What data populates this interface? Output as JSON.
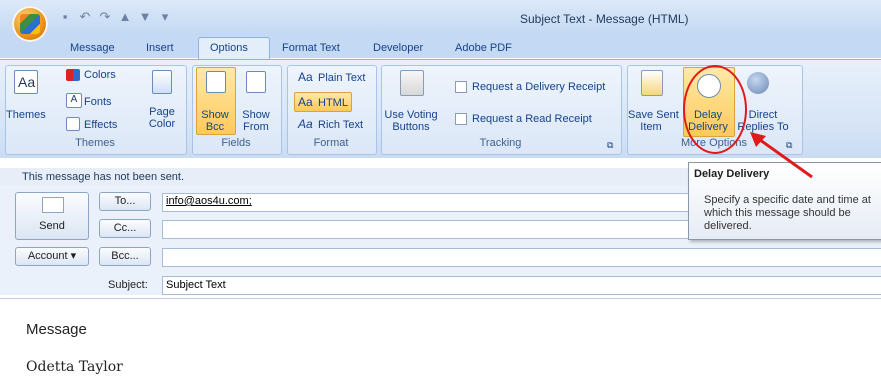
{
  "window": {
    "title": "Subject Text - Message (HTML)"
  },
  "qat": [
    "save-icon",
    "undo-icon",
    "redo-icon",
    "up-arrow-icon",
    "down-arrow-icon",
    "customize-icon"
  ],
  "tabs": [
    "Message",
    "Insert",
    "Options",
    "Format Text",
    "Developer",
    "Adobe PDF"
  ],
  "ribbon": {
    "themes": {
      "group": "Themes",
      "themes": "Themes",
      "colors": "Colors",
      "fonts": "Fonts",
      "effects": "Effects",
      "page_color": "Page\nColor"
    },
    "fields": {
      "group": "Fields",
      "show_bcc": "Show\nBcc",
      "show_from": "Show\nFrom"
    },
    "format": {
      "group": "Format",
      "plain": "Plain Text",
      "html": "HTML",
      "rich": "Rich Text",
      "aa": "Aa"
    },
    "tracking": {
      "group": "Tracking",
      "voting": "Use Voting\nButtons",
      "delivery_receipt": "Request a Delivery Receipt",
      "read_receipt": "Request a Read Receipt"
    },
    "more_options": {
      "group": "More Options",
      "save_sent": "Save Sent\nItem",
      "delay": "Delay\nDelivery",
      "direct": "Direct\nReplies To"
    }
  },
  "infobar": "This message has not been sent.",
  "compose": {
    "send": "Send",
    "to_btn": "To...",
    "cc_btn": "Cc...",
    "bcc_btn": "Bcc...",
    "account": "Account",
    "subject_label": "Subject:",
    "to_value": "info@aos4u.com;",
    "subject_value": "Subject Text"
  },
  "body": {
    "line1": "Message",
    "line2": "Odetta Taylor"
  },
  "tooltip": {
    "title": "Delay Delivery",
    "text": "Specify a specific date and time at which this message should be delivered."
  },
  "colors": {
    "annotation": "#e01b1b",
    "tab_text": "#15428b"
  }
}
